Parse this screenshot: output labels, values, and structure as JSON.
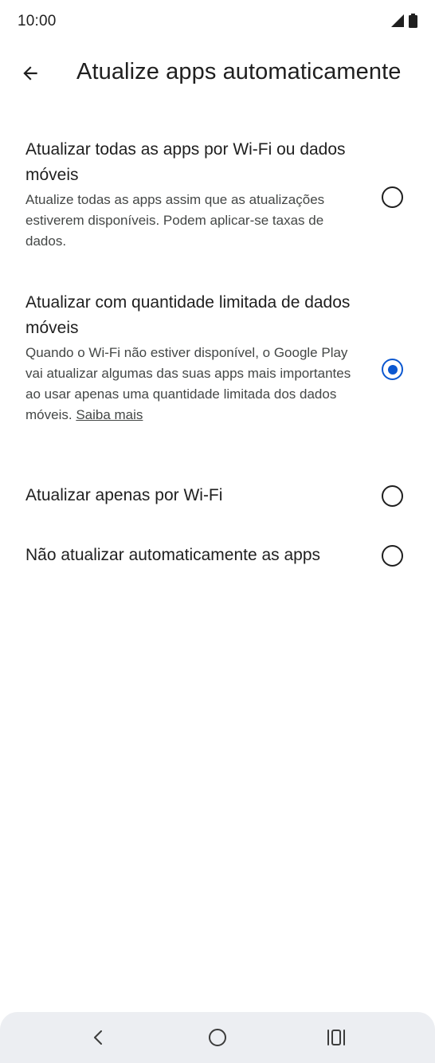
{
  "status_bar": {
    "time": "10:00",
    "icons": [
      "signal-icon",
      "battery-icon"
    ]
  },
  "app_bar": {
    "back_icon": "arrow-left-icon",
    "title": "Atualize apps automaticamente"
  },
  "options": [
    {
      "title": "Atualizar todas as apps por Wi-Fi ou dados móveis",
      "description": "Atualize todas as apps assim que as atualizações estiverem disponíveis. Podem aplicar-se taxas de dados.",
      "selected": false
    },
    {
      "title": "Atualizar com quantidade limitada de dados móveis",
      "description": "Quando o Wi-Fi não estiver disponível, o Google Play vai atualizar algumas das suas apps mais importantes ao usar apenas uma quantidade limitada dos dados móveis.",
      "link": "Saiba mais",
      "selected": true
    },
    {
      "title": "Atualizar apenas por Wi-Fi",
      "selected": false
    },
    {
      "title": "Não atualizar automaticamente as apps",
      "selected": false
    }
  ],
  "nav_bar": {
    "buttons": [
      "back-chevron-icon",
      "home-circle-icon",
      "recents-icon"
    ]
  },
  "colors": {
    "accent": "#0b57d0",
    "text_primary": "#1f1f1f",
    "text_secondary": "#444746",
    "nav_background": "#eceef2"
  }
}
